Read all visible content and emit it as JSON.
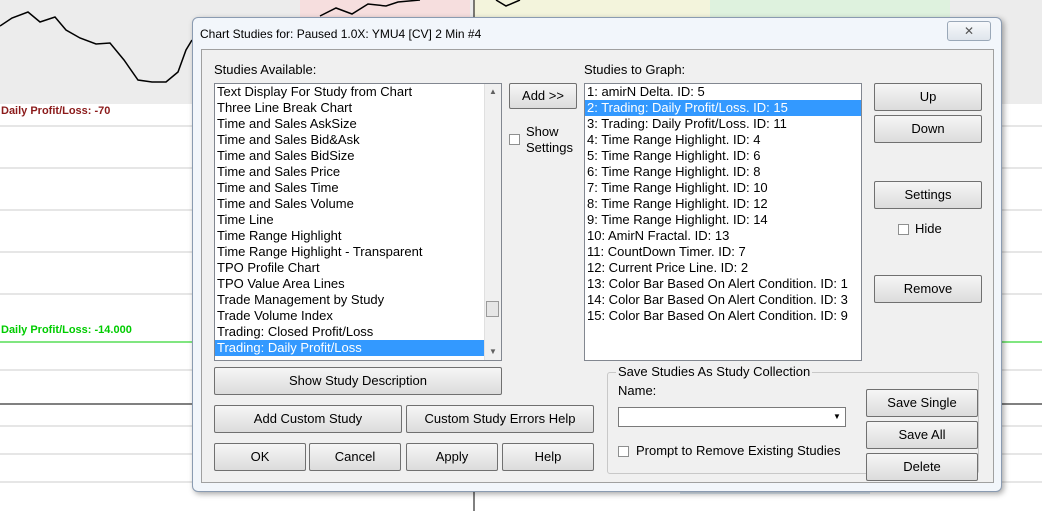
{
  "background_chart": {
    "label_top": "Daily Profit/Loss: -70",
    "label_mid": "Daily Profit/Loss: -14.000",
    "label_top_color": "#8b1a1a",
    "label_mid_color": "#00cc00"
  },
  "dialog": {
    "title": "Chart Studies for: Paused 1.0X: YMU4 [CV]  2 Min   #4",
    "close_glyph": "✕"
  },
  "studies_available": {
    "label": "Studies Available:",
    "items": [
      "Text Display For Study from Chart",
      "Three Line Break Chart",
      "Time and Sales AskSize",
      "Time and Sales Bid&Ask",
      "Time and Sales BidSize",
      "Time and Sales Price",
      "Time and Sales Time",
      "Time and Sales Volume",
      "Time Line",
      "Time Range Highlight",
      "Time Range Highlight - Transparent",
      "TPO Profile Chart",
      "TPO Value Area Lines",
      "Trade Management by Study",
      "Trade Volume Index",
      "Trading: Closed Profit/Loss",
      "Trading: Daily Profit/Loss"
    ],
    "selected_index": 16,
    "scroll_up_glyph": "▲",
    "scroll_down_glyph": "▼",
    "scroll_position": 0.88
  },
  "middle": {
    "add_label": "Add >>",
    "show_settings_line1": "Show",
    "show_settings_line2": "Settings"
  },
  "studies_to_graph": {
    "label": "Studies to Graph:",
    "items": [
      "1: amirN Delta. ID: 5",
      "2: Trading: Daily Profit/Loss. ID: 15",
      "3: Trading: Daily Profit/Loss. ID: 11",
      "4: Time Range Highlight. ID: 4",
      "5: Time Range Highlight. ID: 6",
      "6: Time Range Highlight. ID: 8",
      "7: Time Range Highlight. ID: 10",
      "8: Time Range Highlight. ID: 12",
      "9: Time Range Highlight. ID: 14",
      "10: AmirN Fractal. ID: 13",
      "11: CountDown Timer. ID: 7",
      "12: Current Price Line. ID: 2",
      "13: Color Bar Based On Alert Condition. ID: 1",
      "14: Color Bar Based On Alert Condition. ID: 3",
      "15: Color Bar Based On Alert Condition. ID: 9"
    ],
    "selected_index": 1
  },
  "right_buttons": {
    "up": "Up",
    "down": "Down",
    "settings": "Settings",
    "hide": "Hide",
    "remove": "Remove"
  },
  "bottom_buttons": {
    "show_description": "Show Study Description",
    "add_custom": "Add Custom Study",
    "custom_errors": "Custom Study Errors Help",
    "ok": "OK",
    "cancel": "Cancel",
    "apply": "Apply",
    "help": "Help"
  },
  "collection": {
    "title": "Save Studies As Study Collection",
    "name_label": "Name:",
    "name_value": "",
    "dropdown_glyph": "▼",
    "prompt_label": "Prompt to Remove Existing Studies",
    "save_single": "Save Single",
    "save_all": "Save All",
    "delete": "Delete"
  }
}
